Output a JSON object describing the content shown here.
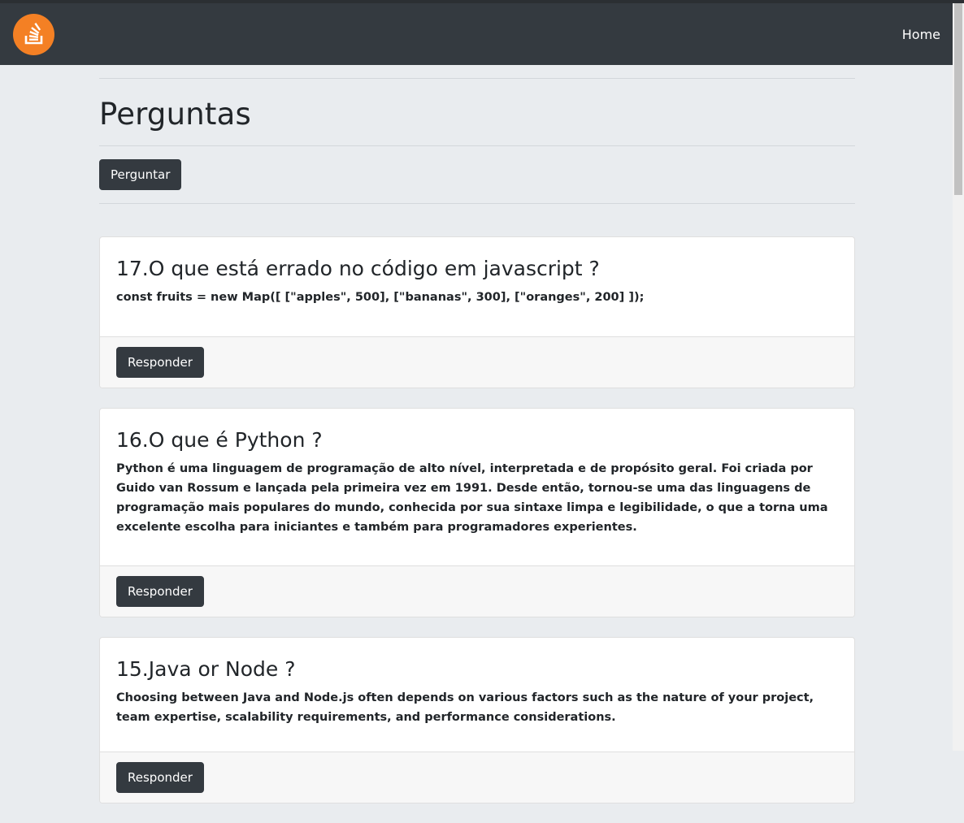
{
  "nav": {
    "home_label": "Home",
    "logo_icon": "stackoverflow-logo-icon",
    "accent": "#f48024"
  },
  "page": {
    "title": "Perguntas",
    "ask_label": "Perguntar"
  },
  "questions": [
    {
      "title": "17.O que está errado no código em javascript ?",
      "body": "const fruits = new Map([ [\"apples\", 500], [\"bananas\", 300], [\"oranges\", 200] ]);",
      "answer_label": "Responder"
    },
    {
      "title": "16.O que é Python ?",
      "body": "Python é uma linguagem de programação de alto nível, interpretada e de propósito geral. Foi criada por Guido van Rossum e lançada pela primeira vez em 1991. Desde então, tornou-se uma das linguagens de programação mais populares do mundo, conhecida por sua sintaxe limpa e legibilidade, o que a torna uma excelente escolha para iniciantes e também para programadores experientes.",
      "answer_label": "Responder"
    },
    {
      "title": "15.Java or Node ?",
      "body": "Choosing between Java and Node.js often depends on various factors such as the nature of your project, team expertise, scalability requirements, and performance considerations.",
      "answer_label": "Responder"
    }
  ]
}
